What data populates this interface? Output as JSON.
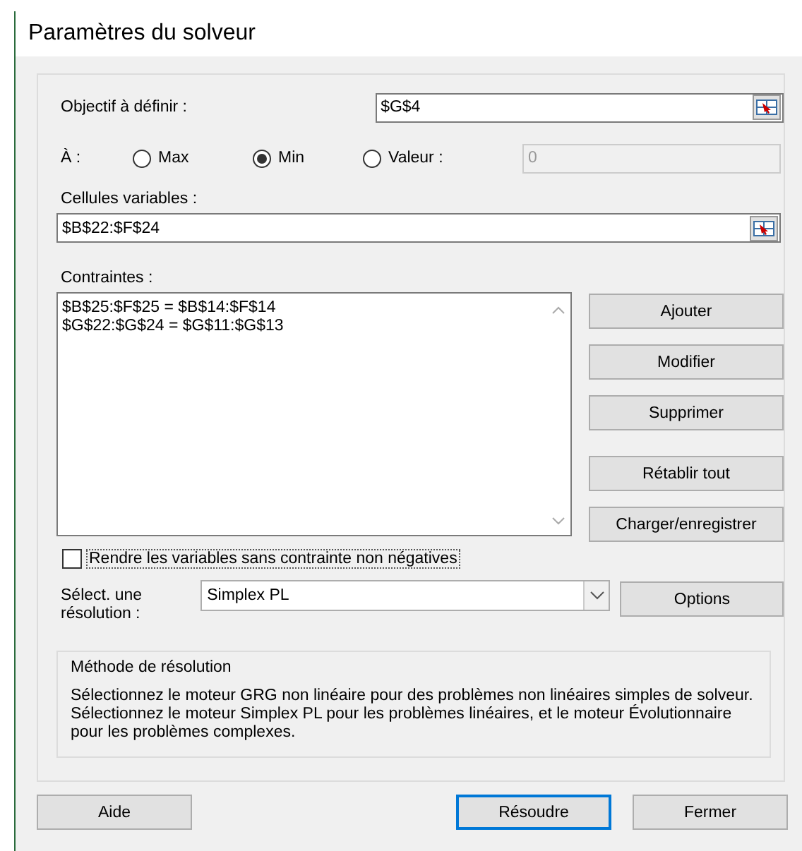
{
  "window": {
    "title": "Paramètres du solveur"
  },
  "objective": {
    "label": "Objectif à définir :",
    "value": "$G$4"
  },
  "to": {
    "label": "À :",
    "options": [
      {
        "label": "Max",
        "selected": false
      },
      {
        "label": "Min",
        "selected": true
      },
      {
        "label": "Valeur :",
        "selected": false
      }
    ],
    "value_field": {
      "value": "0",
      "disabled": true
    }
  },
  "variable_cells": {
    "label": "Cellules variables :",
    "value": "$B$22:$F$24"
  },
  "constraints": {
    "label": "Contraintes :",
    "items": [
      "$B$25:$F$25 = $B$14:$F$14",
      "$G$22:$G$24 = $G$11:$G$13"
    ],
    "buttons": [
      {
        "label": "Ajouter",
        "gap_before": false
      },
      {
        "label": "Modifier",
        "gap_before": false
      },
      {
        "label": "Supprimer",
        "gap_before": false
      },
      {
        "label": "Rétablir tout",
        "gap_before": true
      },
      {
        "label": "Charger/enregistrer",
        "gap_before": false
      }
    ]
  },
  "nonnegative": {
    "label": "Rendre les variables sans contrainte non négatives",
    "checked": false
  },
  "method": {
    "label": "Sélect. une résolution :",
    "value": "Simplex PL",
    "options_button": "Options"
  },
  "method_info": {
    "title": "Méthode de résolution",
    "text": "Sélectionnez le moteur GRG non linéaire pour des problèmes non linéaires simples de solveur. Sélectionnez le moteur Simplex PL pour les problèmes linéaires, et le moteur Évolutionnaire pour les problèmes complexes."
  },
  "buttons": [
    {
      "label": "Aide",
      "default": false
    },
    {
      "label": "Résoudre",
      "default": true
    },
    {
      "label": "Fermer",
      "default": false
    }
  ]
}
